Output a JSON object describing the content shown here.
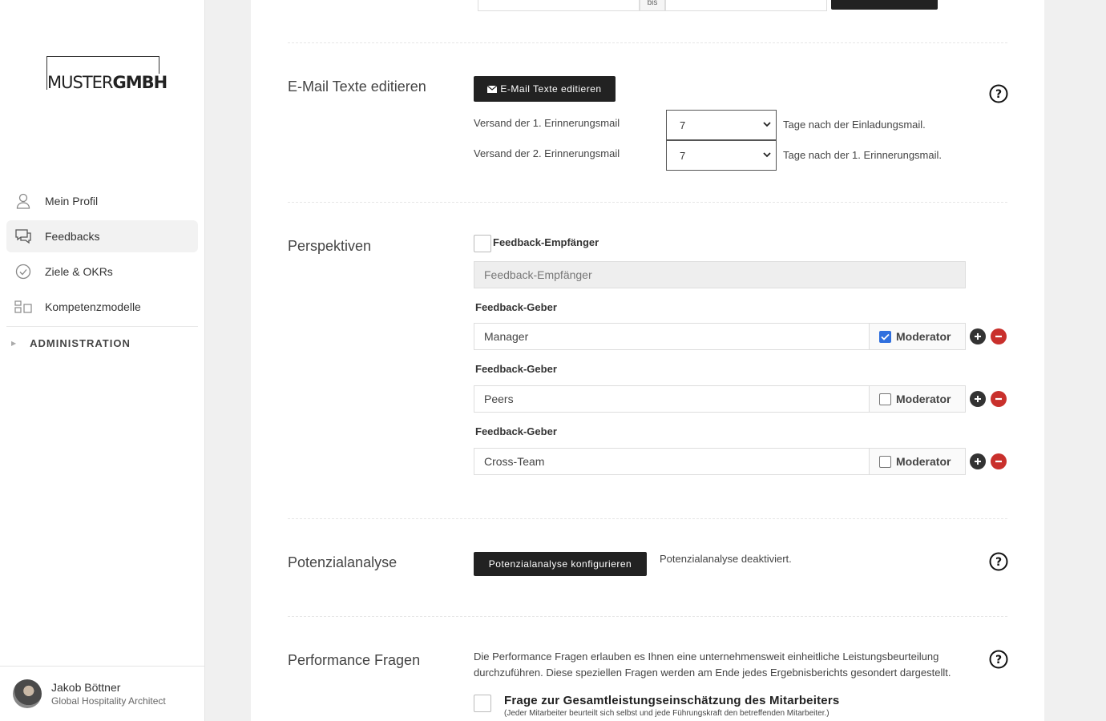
{
  "brand": {
    "logo_light": "MUSTER",
    "logo_bold": "GMBH"
  },
  "nav": {
    "items": [
      {
        "label": "Mein Profil",
        "icon": "person-icon"
      },
      {
        "label": "Feedbacks",
        "icon": "chat-bubbles-icon"
      },
      {
        "label": "Ziele & OKRs",
        "icon": "check-circle-icon"
      },
      {
        "label": "Kompetenzmodelle",
        "icon": "model-blocks-icon"
      }
    ],
    "admin": "ADMINISTRATION"
  },
  "user": {
    "name": "Jakob Böttner",
    "role": "Global Hospitality Architect"
  },
  "top": {
    "range_sep": "bis"
  },
  "email": {
    "title": "E-Mail Texte editieren",
    "button": "E-Mail Texte editieren",
    "reminder1_label": "Versand der 1. Erinnerungsmail",
    "reminder1_value": "7",
    "reminder1_suffix": "Tage nach der Einladungsmail.",
    "reminder2_label": "Versand der 2. Erinnerungsmail",
    "reminder2_value": "7",
    "reminder2_suffix": "Tage nach der 1. Erinnerungsmail."
  },
  "perspectives": {
    "title": "Perspektiven",
    "receiver_label": "Feedback-Empfänger",
    "receiver_placeholder": "Feedback-Empfänger",
    "giver_label": "Feedback-Geber",
    "moderator_label": "Moderator",
    "givers": [
      {
        "value": "Manager",
        "moderator": true
      },
      {
        "value": "Peers",
        "moderator": false
      },
      {
        "value": "Cross-Team",
        "moderator": false
      }
    ]
  },
  "potential": {
    "title": "Potenzialanalyse",
    "button": "Potenzialanalyse konfigurieren",
    "status": "Potenzialanalyse deaktiviert."
  },
  "performance": {
    "title": "Performance Fragen",
    "description": "Die Performance Fragen erlauben es Ihnen eine unternehmensweit einheitliche Leistungsbeurteilung durchzuführen. Diese speziellen Fragen werden am Ende jedes Ergebnisberichts gesondert dargestellt.",
    "question": "Frage zur Gesamtleistungseinschätzung des Mitarbeiters",
    "question_note": "(Jeder Mitarbeiter beurteilt sich selbst und jede Führungskraft den betreffenden Mitarbeiter.)"
  },
  "colors": {
    "dark_button": "#222222",
    "accent_blue": "#2f6fde",
    "remove_red": "#c9302c"
  }
}
